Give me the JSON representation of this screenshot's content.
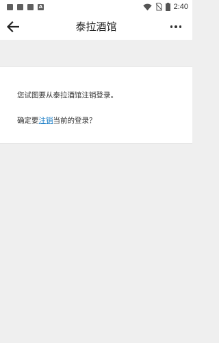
{
  "status_bar": {
    "time": "2:40",
    "notification_icons": [
      "image-icon",
      "image-icon",
      "image-icon",
      "a-app-icon"
    ],
    "a_icon_letter": "A",
    "right_icons": [
      "wifi-icon",
      "no-sim-icon",
      "battery-icon"
    ]
  },
  "toolbar": {
    "title": "泰拉酒馆",
    "back_icon": "arrow-left-icon",
    "more_icon": "more-horizontal-icon"
  },
  "dialog": {
    "message_line1": "您试图要从泰拉酒馆注销登录。",
    "confirm_prefix": "确定要",
    "logout_link": "注销",
    "confirm_suffix": "当前的登录？"
  },
  "colors": {
    "background": "#efefef",
    "link": "#1a7dc6",
    "text": "#333333"
  }
}
